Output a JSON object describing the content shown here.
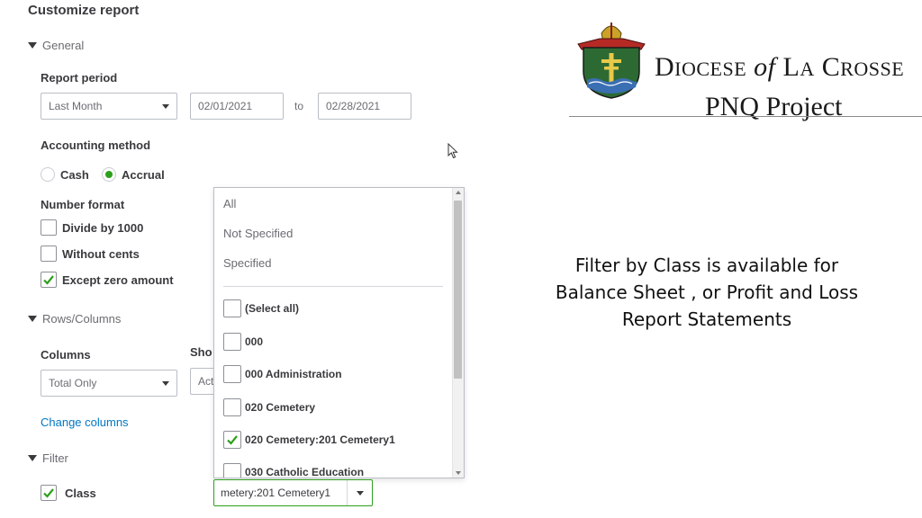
{
  "panel": {
    "title": "Customize report",
    "general": {
      "toggle_label": "General",
      "report_period": {
        "label": "Report period",
        "selected": "Last Month",
        "start_date": "02/01/2021",
        "to_label": "to",
        "end_date": "02/28/2021"
      },
      "accounting_method": {
        "label": "Accounting method",
        "options": [
          {
            "label": "Cash",
            "selected": false
          },
          {
            "label": "Accrual",
            "selected": true
          }
        ]
      },
      "number_format": {
        "label": "Number format",
        "options": [
          {
            "label": "Divide by 1000",
            "checked": false
          },
          {
            "label": "Without cents",
            "checked": false
          },
          {
            "label": "Except zero amount",
            "checked": true
          }
        ]
      }
    },
    "rows_columns": {
      "toggle_label": "Rows/Columns",
      "columns_label": "Columns",
      "columns_selected": "Total Only",
      "show_label_partial": "Sho",
      "show_selected_partial": "Act",
      "change_columns_link": "Change columns"
    },
    "filter": {
      "toggle_label": "Filter",
      "class_label": "Class",
      "class_checked": true,
      "class_value": "metery:201 Cemetery1"
    }
  },
  "class_dropdown": {
    "plain_options": [
      "All",
      "Not Specified",
      "Specified"
    ],
    "check_options": [
      {
        "label": "(Select all)",
        "checked": false
      },
      {
        "label": "000",
        "checked": false
      },
      {
        "label": "000 Administration",
        "checked": false
      },
      {
        "label": "020 Cemetery",
        "checked": false
      },
      {
        "label": "020 Cemetery:201 Cemetery1",
        "checked": true
      },
      {
        "label": "030 Catholic Education",
        "checked": false
      }
    ]
  },
  "logo": {
    "line1_d": "D",
    "line1_iocese": "IOCESE",
    "line1_of": "of",
    "line1_l": "L",
    "line1_a": "A",
    "line1_c": "C",
    "line1_rosse": "ROSSE",
    "line2": "PNQ Project"
  },
  "note": {
    "lines": [
      "Filter by Class is available for",
      "Balance Sheet , or Profit and Loss",
      "Report Statements"
    ]
  },
  "colors": {
    "accent_green": "#2ca01c",
    "link_blue": "#0077c5"
  }
}
